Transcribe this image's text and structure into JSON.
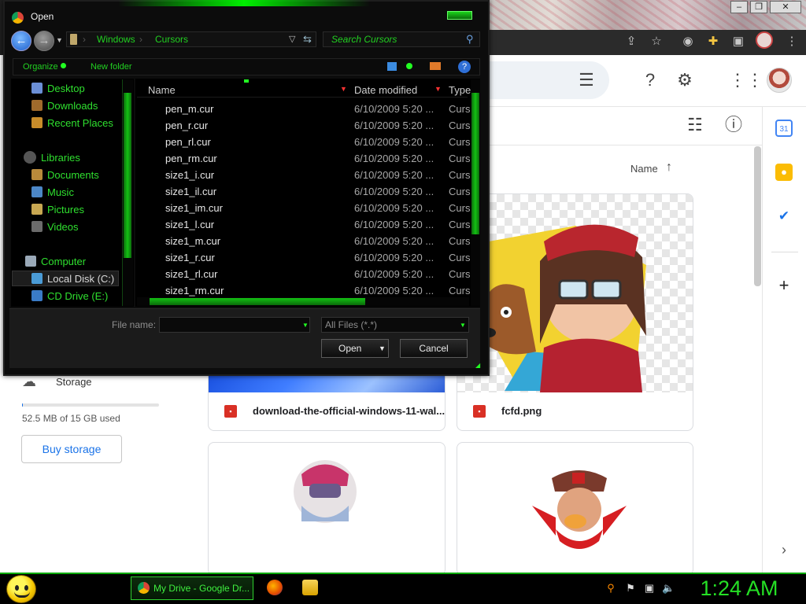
{
  "dialog": {
    "title": "Open",
    "address": {
      "segments": [
        "Windows",
        "Cursors"
      ]
    },
    "search_placeholder": "Search Cursors",
    "toolbar": {
      "organize": "Organize",
      "new_folder": "New folder"
    },
    "nav": [
      {
        "label": "Desktop",
        "color": "#6b8fd6"
      },
      {
        "label": "Downloads",
        "color": "#a06a2c"
      },
      {
        "label": "Recent Places",
        "color": "#c88c2a"
      },
      {
        "label": "Libraries",
        "color": "#555555"
      },
      {
        "label": "Documents",
        "color": "#b98a3b"
      },
      {
        "label": "Music",
        "color": "#4c87c7"
      },
      {
        "label": "Pictures",
        "color": "#c8a852"
      },
      {
        "label": "Videos",
        "color": "#6b6b6b"
      },
      {
        "label": "Computer",
        "color": "#9aa9b8"
      },
      {
        "label": "Local Disk (C:)",
        "color": "#4a9bd6"
      },
      {
        "label": "CD Drive (E:)",
        "color": "#3a7bc6"
      }
    ],
    "columns": {
      "name": "Name",
      "date": "Date modified",
      "type": "Type"
    },
    "files": [
      {
        "name": "pen_m.cur",
        "date": "6/10/2009 5:20 ...",
        "type": "Curs"
      },
      {
        "name": "pen_r.cur",
        "date": "6/10/2009 5:20 ...",
        "type": "Curs"
      },
      {
        "name": "pen_rl.cur",
        "date": "6/10/2009 5:20 ...",
        "type": "Curs"
      },
      {
        "name": "pen_rm.cur",
        "date": "6/10/2009 5:20 ...",
        "type": "Curs"
      },
      {
        "name": "size1_i.cur",
        "date": "6/10/2009 5:20 ...",
        "type": "Curs"
      },
      {
        "name": "size1_il.cur",
        "date": "6/10/2009 5:20 ...",
        "type": "Curs"
      },
      {
        "name": "size1_im.cur",
        "date": "6/10/2009 5:20 ...",
        "type": "Curs"
      },
      {
        "name": "size1_l.cur",
        "date": "6/10/2009 5:20 ...",
        "type": "Curs"
      },
      {
        "name": "size1_m.cur",
        "date": "6/10/2009 5:20 ...",
        "type": "Curs"
      },
      {
        "name": "size1_r.cur",
        "date": "6/10/2009 5:20 ...",
        "type": "Curs"
      },
      {
        "name": "size1_rl.cur",
        "date": "6/10/2009 5:20 ...",
        "type": "Curs"
      },
      {
        "name": "size1_rm.cur",
        "date": "6/10/2009 5:20 ...",
        "type": "Curs"
      }
    ],
    "file_name_label": "File name:",
    "file_name_value": "",
    "file_type": "All Files (*.*)",
    "open_label": "Open",
    "cancel_label": "Cancel"
  },
  "drive": {
    "sort_label": "Name",
    "storage_label": "Storage",
    "storage_used": "52.5 MB of 15 GB used",
    "storage_fraction": 0.0035,
    "buy_storage": "Buy storage",
    "files": [
      {
        "name": "download-the-official-windows-11-wal..."
      },
      {
        "name": "fcfd.png"
      }
    ]
  },
  "taskbar": {
    "task_chrome": "My Drive - Google Dr...",
    "clock": "1:24 AM"
  },
  "colors": {
    "accent_green": "#21d021",
    "dialog_bg": "#0c0c0c"
  }
}
